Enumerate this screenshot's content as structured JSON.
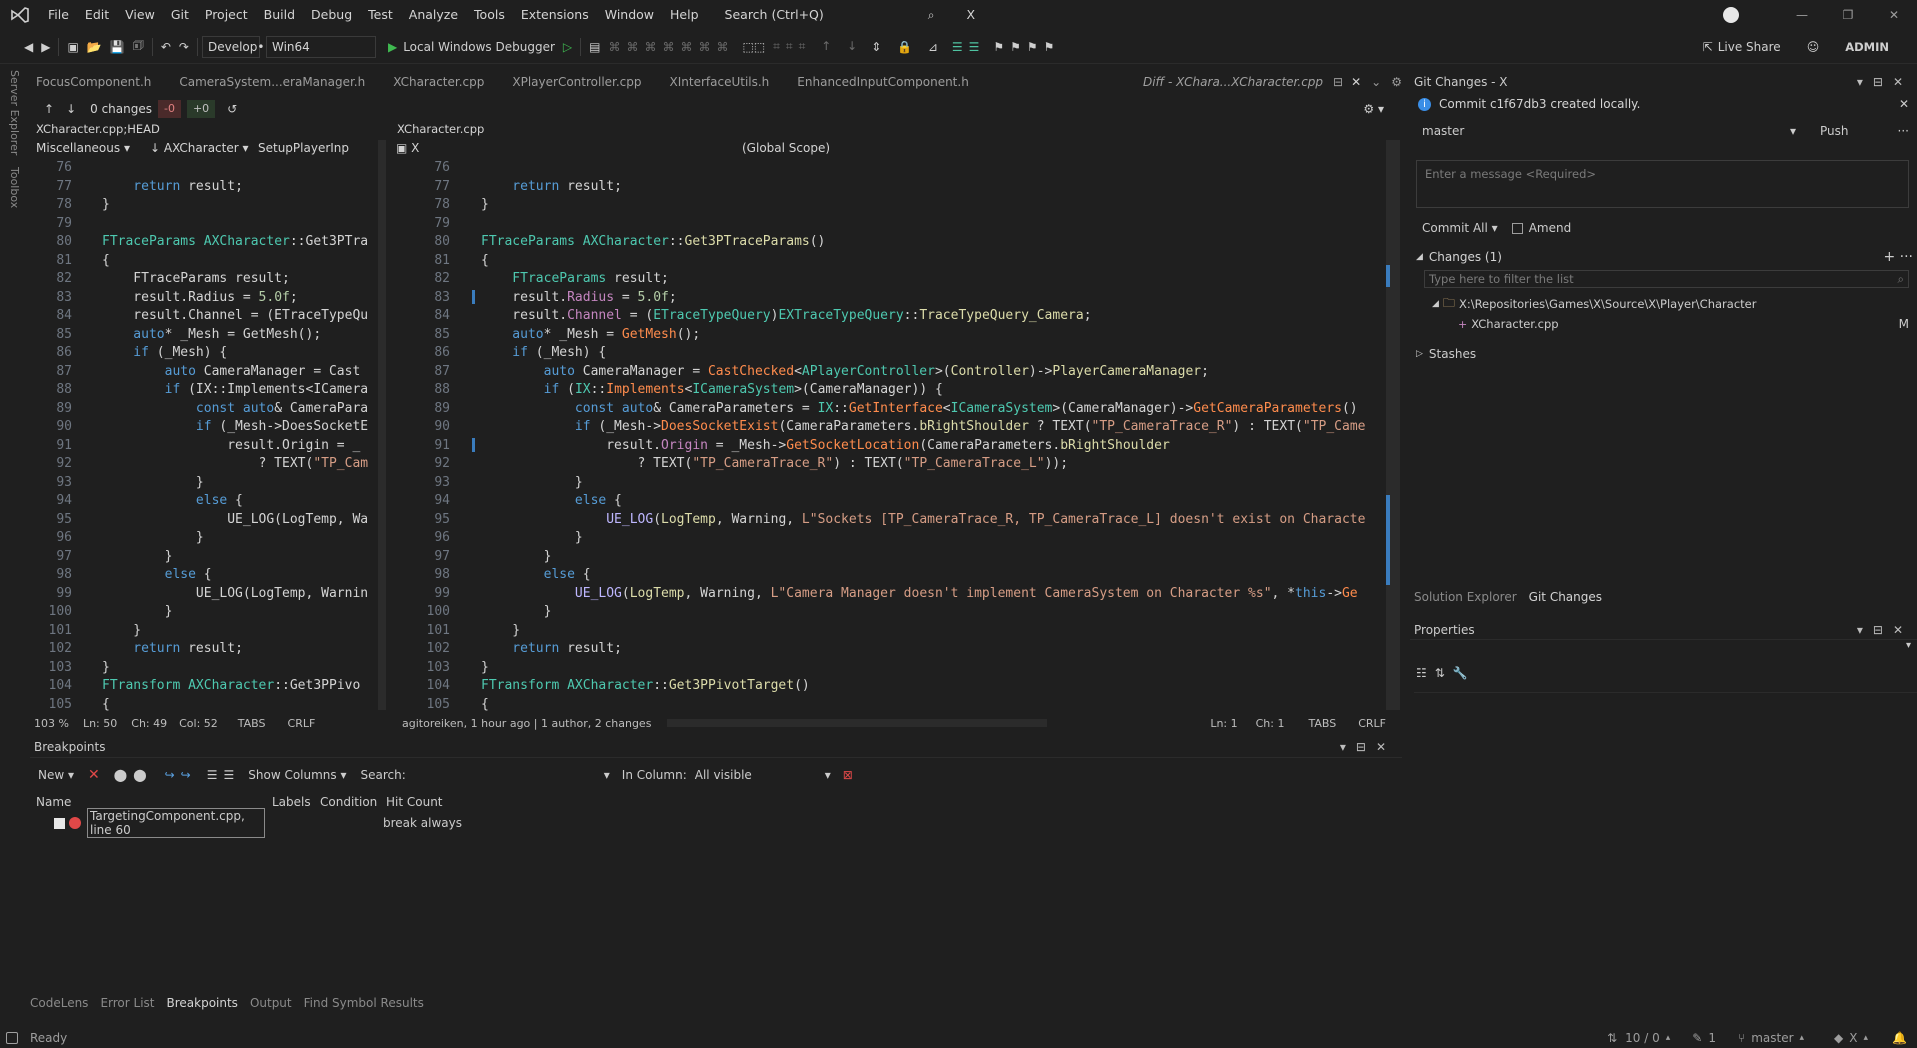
{
  "menubar": {
    "items": [
      "File",
      "Edit",
      "View",
      "Git",
      "Project",
      "Build",
      "Debug",
      "Test",
      "Analyze",
      "Tools",
      "Extensions",
      "Window",
      "Help"
    ],
    "search": "Search (Ctrl+Q)",
    "solution": "X",
    "user_icon": "avatar-icon"
  },
  "toolbar": {
    "config": "Develop•",
    "platform": "Win64",
    "debugger": "Local Windows Debugger",
    "live_share": "Live Share",
    "admin": "ADMIN"
  },
  "side_tools": [
    "Server Explorer",
    "Toolbox"
  ],
  "tabs": [
    "FocusComponent.h",
    "CameraSystem...eraManager.h",
    "XCharacter.cpp",
    "XPlayerController.cpp",
    "XInterfaceUtils.h",
    "EnhancedInputComponent.h",
    "Diff - XChara...XCharacter.cpp"
  ],
  "diffbar": {
    "changes": "0 changes",
    "removed": "-0",
    "added": "+0"
  },
  "left_pane": {
    "title": "XCharacter.cpp;HEAD",
    "nav": [
      "Miscellaneous",
      "AXCharacter",
      "SetupPlayerInp"
    ]
  },
  "right_pane": {
    "title": "XCharacter.cpp",
    "nav": [
      "X",
      "(Global Scope)"
    ]
  },
  "line_numbers": [
    "76",
    "77",
    "78",
    "79",
    "80",
    "81",
    "82",
    "83",
    "84",
    "85",
    "86",
    "87",
    "88",
    "89",
    "90",
    "91",
    "92",
    "93",
    "94",
    "95",
    "96",
    "97",
    "98",
    "99",
    "100",
    "101",
    "102",
    "103",
    "104",
    "105"
  ],
  "left_status": {
    "zoom": "103 %",
    "ln": "Ln: 50",
    "ch": "Ch: 49",
    "col": "Col: 52",
    "tabs": "TABS",
    "eol": "CRLF"
  },
  "right_status": {
    "blame": "agitoreiken, 1 hour ago | 1 author, 2 changes",
    "ln": "Ln: 1",
    "ch": "Ch: 1",
    "tabs": "TABS",
    "eol": "CRLF"
  },
  "breakpoints": {
    "title": "Breakpoints",
    "new": "New",
    "show_columns": "Show Columns",
    "search_label": "Search:",
    "in_column": "In Column:",
    "in_column_value": "All visible",
    "cols": [
      "Name",
      "Labels",
      "Condition",
      "Hit Count"
    ],
    "rows": [
      {
        "name": "TargetingComponent.cpp, line 60",
        "hit": "break always"
      }
    ]
  },
  "bottom_tabs": [
    "CodeLens",
    "Error List",
    "Breakpoints",
    "Output",
    "Find Symbol Results"
  ],
  "git": {
    "title": "Git Changes - X",
    "notice": "Commit c1f67db3 created locally.",
    "branch": "master",
    "push": "Push",
    "message_placeholder": "Enter a message <Required>",
    "commit_all": "Commit All",
    "amend": "Amend",
    "changes": "Changes (1)",
    "filter_placeholder": "Type here to filter the list",
    "folder": "X:\\Repositories\\Games\\X\\Source\\X\\Player\\Character",
    "file": "XCharacter.cpp",
    "file_status": "M",
    "stashes": "Stashes",
    "tabs": [
      "Solution Explorer",
      "Git Changes"
    ]
  },
  "props": {
    "title": "Properties"
  },
  "status": {
    "ready": "Ready",
    "sync": "10 / 0",
    "pencil": "1",
    "branch": "master",
    "repo": "X"
  }
}
